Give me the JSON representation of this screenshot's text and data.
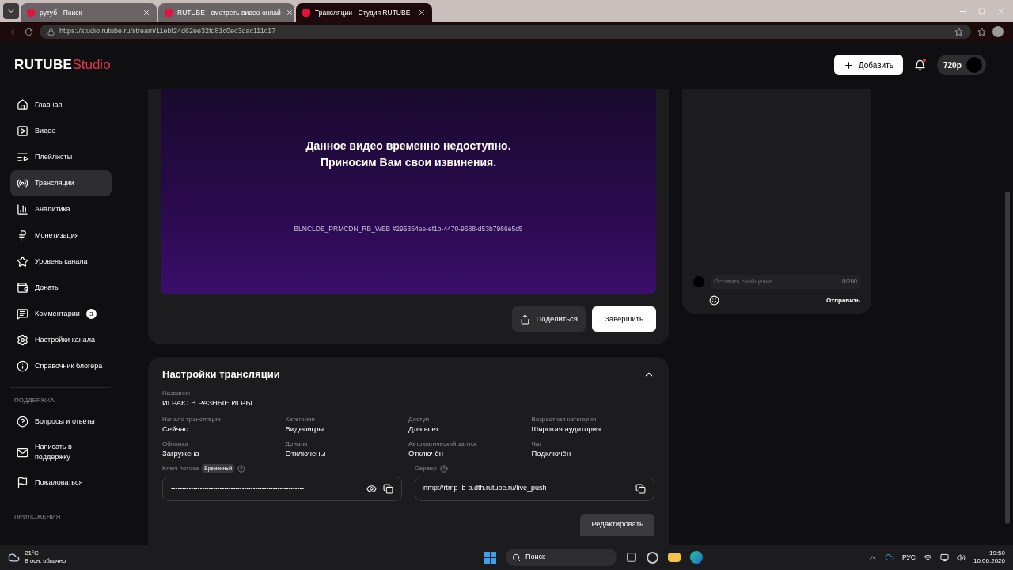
{
  "browser": {
    "tabs": [
      {
        "title": "рутуб - Поиск",
        "selected": false
      },
      {
        "title": "RUTUBE - смотреть видео онлай",
        "selected": false
      },
      {
        "title": "Трансляции - Студия RUTUBE",
        "selected": true
      }
    ],
    "address": "https://studio.rutube.ru/stream/11ebf24d62ee32fd81c0ec3dac111c17"
  },
  "header": {
    "logo": "RUTUBE",
    "logo_suffix": "Studio",
    "add_button": "Добавить",
    "quality": "720p"
  },
  "sidebar": {
    "items": [
      {
        "label": "Главная",
        "selected": false
      },
      {
        "label": "Видео",
        "selected": false
      },
      {
        "label": "Плейлисты",
        "selected": false
      },
      {
        "label": "Трансляции",
        "selected": true
      },
      {
        "label": "Аналитика",
        "selected": false
      },
      {
        "label": "Монетизация",
        "selected": false
      },
      {
        "label": "Уровень канала",
        "selected": false
      },
      {
        "label": "Донаты",
        "selected": false
      },
      {
        "label": "Комментарии",
        "selected": false,
        "badge": "3"
      },
      {
        "label": "Настройки канала",
        "selected": false
      },
      {
        "label": "Справочник блогера",
        "selected": false
      }
    ],
    "support_title": "ПОДДЕРЖКА",
    "support_items": [
      {
        "label": "Вопросы и ответы",
        "selected": false
      },
      {
        "label": "Написать в поддержку",
        "selected": false
      },
      {
        "label": "Пожаловаться",
        "selected": false
      }
    ],
    "apps_title": "ПРИЛОЖЕНИЯ"
  },
  "player": {
    "message": [
      "Данное видео временно недоступно.",
      "Приносим Вам свои извинения."
    ],
    "error_code": "BLNCLDE_PRMCDN_RB_WEB #295354ee-ef1b-4470-9688-d53b7966e5d5",
    "share_button": "Поделиться",
    "finish_button": "Завершить"
  },
  "chat": {
    "placeholder": "Оставить сообщение...",
    "counter": "0/200",
    "send_button": "Отправить"
  },
  "settings": {
    "title": "Настройки трансляции",
    "expanded": true,
    "name": {
      "label": "Название",
      "value": "ИГРАЮ В РАЗНЫЕ ИГРЫ"
    },
    "fields": [
      {
        "label": "Начало трансляции",
        "value": "Сейчас"
      },
      {
        "label": "Категория",
        "value": "Видеоигры"
      },
      {
        "label": "Доступ",
        "value": "Для всех"
      },
      {
        "label": "Возрастная категория",
        "value": "Широкая аудитория"
      },
      {
        "label": "Обложка",
        "value": "Загружена"
      },
      {
        "label": "Донаты",
        "value": "Отключены"
      },
      {
        "label": "Автоматический запуск",
        "value": "Отключён"
      },
      {
        "label": "Чат",
        "value": "Подключён"
      }
    ],
    "stream_key": {
      "label": "Ключ потока",
      "badge": "Временный",
      "value": "••••••••••••••••••••••••••••••••••••••••••••••••••••••••••••"
    },
    "server": {
      "label": "Сервер",
      "value": "rtmp://rtmp-lb-b.dth.rutube.ru/live_push"
    },
    "edit_button": "Редактировать"
  },
  "taskbar": {
    "temperature": "21°C",
    "weather": "В осн. облачно",
    "search": "Поиск",
    "language": "РУС",
    "time": "19:50",
    "date": "10.06.2026"
  }
}
